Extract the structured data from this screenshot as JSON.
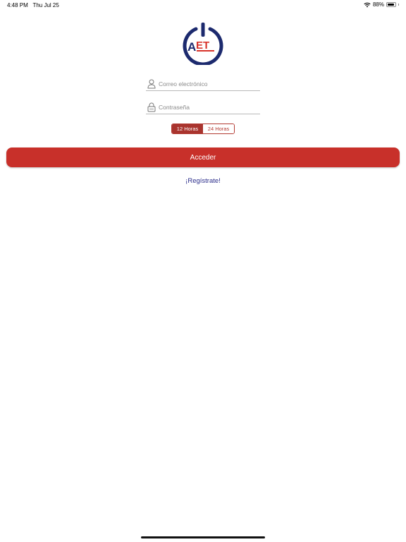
{
  "status_bar": {
    "time": "4:48 PM",
    "date": "Thu Jul 25",
    "battery_percent": "88%",
    "battery_level": 0.88,
    "wifi_icon": "wifi-icon",
    "battery_icon": "battery-icon"
  },
  "logo": {
    "text": "AET",
    "colors": {
      "navy": "#1c2a6e",
      "red": "#d8322a"
    },
    "icon": "power-logo-icon"
  },
  "login": {
    "email_placeholder": "Correo electrónico",
    "email_value": "",
    "email_icon": "user-icon",
    "password_placeholder": "Contraseña",
    "password_value": "",
    "password_icon": "lock-icon"
  },
  "time_format": {
    "options": [
      "12 Horas",
      "24 Horas"
    ],
    "selected": "12 Horas"
  },
  "actions": {
    "submit_label": "Acceder",
    "register_label": "¡Regístrate!"
  },
  "colors": {
    "accent": "#c8302a",
    "segment_active": "#a9342e",
    "link": "#2a2c8a"
  }
}
